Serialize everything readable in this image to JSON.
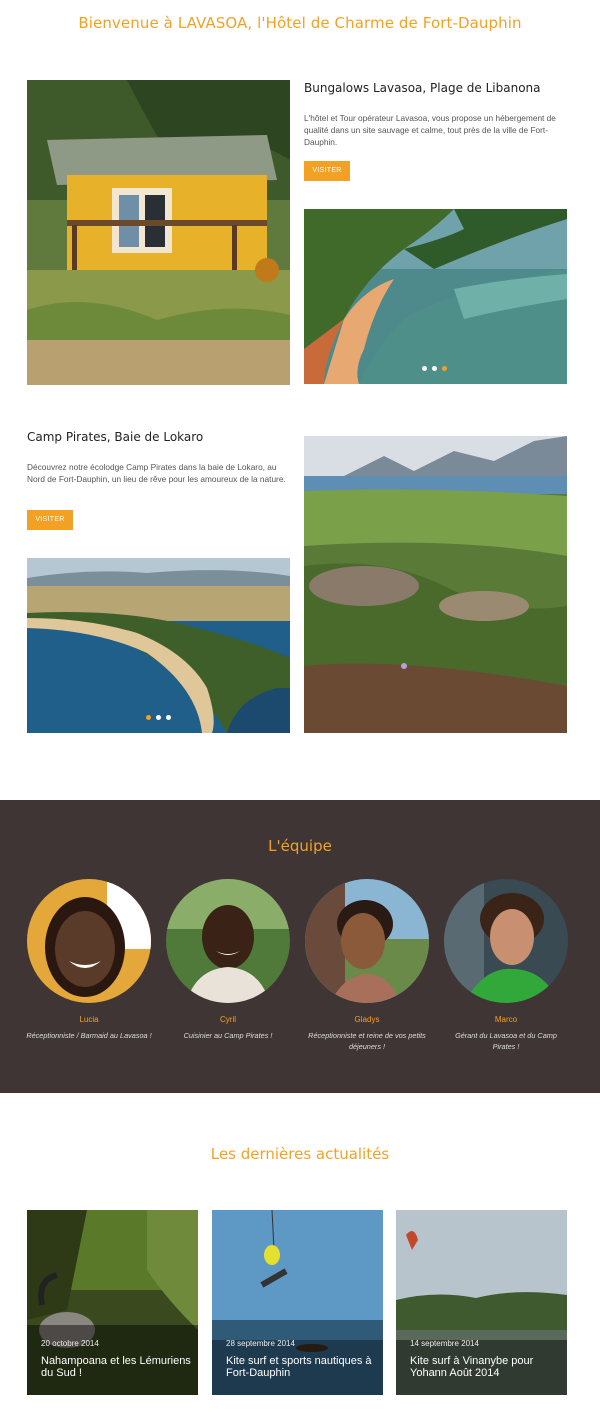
{
  "header": {
    "title": "Bienvenue à LAVASOA, l'Hôtel de Charme de Fort-Dauphin"
  },
  "properties": [
    {
      "title": "Bungalows Lavasoa, Plage de Libanona",
      "description": "L'hôtel et Tour opérateur Lavasoa, vous propose un hébergement de qualité dans un site sauvage et calme, tout près de la ville de Fort-Dauphin.",
      "button": "VISITER"
    },
    {
      "title": "Camp Pirates, Baie de Lokaro",
      "description": "Découvrez notre écolodge Camp Pirates dans la baie de Lokaro, au Nord de Fort-Dauphin, un lieu de rêve pour les amoureux de la nature.",
      "button": "VISITER"
    }
  ],
  "team": {
    "title": "L'équipe",
    "members": [
      {
        "name": "Lucia",
        "role": "Réceptionniste / Barmaid au Lavasoa !"
      },
      {
        "name": "Cyril",
        "role": "Cuisinier au Camp Pirates !"
      },
      {
        "name": "Gladys",
        "role": "Réceptionniste et reine de vos petits déjeuners !"
      },
      {
        "name": "Marco",
        "role": "Gérant du Lavasoa et du Camp Pirates !"
      }
    ]
  },
  "news": {
    "title": "Les dernières actualités",
    "items": [
      {
        "date": "20 octobre 2014",
        "headline": "Nahampoana et les Lémuriens du Sud !"
      },
      {
        "date": "28 septembre 2014",
        "headline": "Kite surf et sports nautiques à Fort-Dauphin"
      },
      {
        "date": "14 septembre 2014",
        "headline": "Kite surf à Vinanybe pour Yohann Août 2014"
      }
    ]
  },
  "colors": {
    "accent": "#f3a125",
    "team_background": "#403535"
  },
  "carousels": {
    "slider1_active": 3,
    "slider2_active": 1,
    "slide_count": 3
  }
}
